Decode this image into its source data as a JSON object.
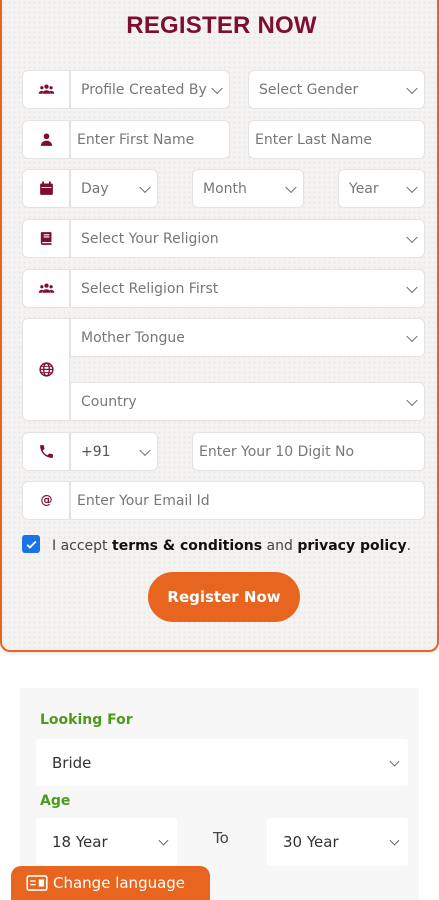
{
  "form": {
    "title": "REGISTER NOW",
    "profile_created_by": "Profile Created By",
    "gender": "Select Gender",
    "first_name_placeholder": "Enter First Name",
    "last_name_placeholder": "Enter Last Name",
    "day": "Day",
    "month": "Month",
    "year": "Year",
    "religion": "Select Your Religion",
    "caste": "Select Religion First",
    "mother_tongue": "Mother Tongue",
    "country": "Country",
    "country_code": "+91",
    "phone_placeholder": "Enter Your 10 Digit No",
    "email_placeholder": "Enter Your Email Id",
    "accept_checked": true,
    "accept_prefix": "I accept ",
    "terms_label": "terms & conditions",
    "and_label": " and ",
    "privacy_label": "privacy policy",
    "period": ".",
    "register_button": "Register Now"
  },
  "search": {
    "looking_for_label": "Looking For",
    "looking_for_value": "Bride",
    "age_label": "Age",
    "age_from": "18 Year",
    "to_label": "To",
    "age_to": "30 Year"
  },
  "language_button": "Change language",
  "icons": {
    "group": "users-icon",
    "person": "user-icon",
    "calendar": "calendar-icon",
    "book": "book-icon",
    "globe": "globe-icon",
    "phone": "phone-icon",
    "email": "at-icon",
    "language": "language-icon"
  },
  "colors": {
    "brand_title": "#7b0f2d",
    "accent": "#e8651f",
    "green_label": "#4c9a1b",
    "checkbox": "#1a73e8"
  }
}
